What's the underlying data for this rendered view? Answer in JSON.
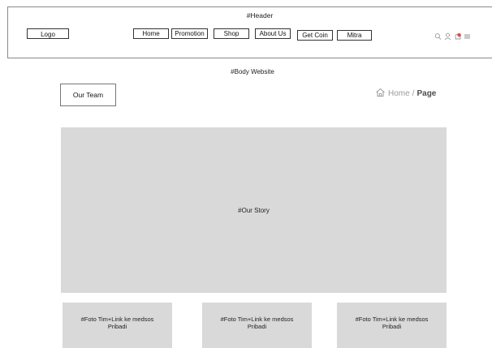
{
  "header": {
    "title": "#Header",
    "logo_label": "Logo",
    "nav": {
      "home": "Home",
      "promotion": "Promotion",
      "shop": "Shop",
      "about": "About Us",
      "coin": "Get Coin",
      "mitra": "Mitra"
    },
    "icons": [
      "search-icon",
      "user-icon",
      "notification-icon",
      "menu-icon"
    ],
    "notification_color": "#e04848"
  },
  "body": {
    "title": "#Body Website",
    "team_button": "Our Team",
    "breadcrumb": {
      "home": "Home",
      "separator": "/",
      "page": "Page"
    },
    "story_label": "#Our Story",
    "cards": [
      {
        "label": "#Foto Tim+Link ke medsos Pribadi"
      },
      {
        "label": "#Foto Tim+Link ke medsos Pribadi"
      },
      {
        "label": "#Foto Tim+Link ke medsos Pribadi"
      }
    ]
  }
}
